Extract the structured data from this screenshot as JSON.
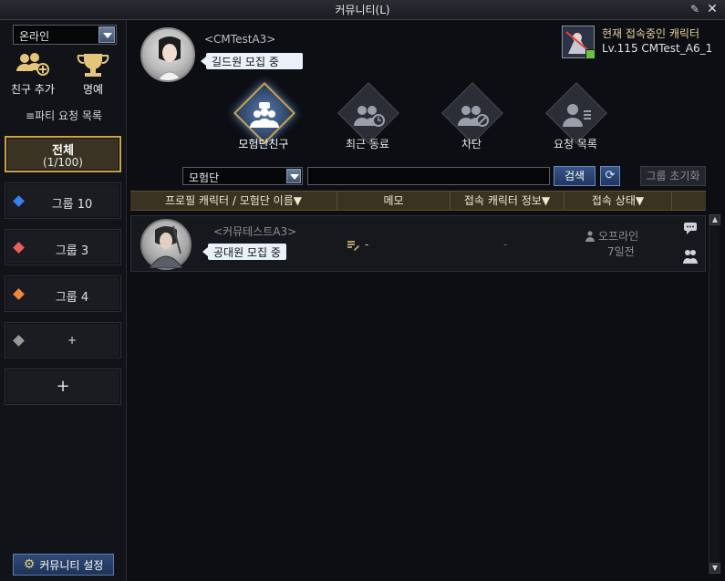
{
  "window": {
    "title": "커뮤니티(L)"
  },
  "sidebar": {
    "status": "온라인",
    "add_friend_label": "친구 추가",
    "honor_label": "명예",
    "party_list_label": "≡파티 요청 목록",
    "groups": [
      {
        "label": "전체",
        "count": "(1/100)",
        "color": "#c9a24a"
      },
      {
        "label": "그룹 10",
        "color": "#3a7ef0"
      },
      {
        "label": "그룹 3",
        "color": "#e8605a"
      },
      {
        "label": "그룹 4",
        "color": "#f08a3a"
      },
      {
        "label": "+",
        "color": "#9a9a9a"
      },
      {
        "label": "+"
      }
    ],
    "settings_label": "커뮤니티 설정"
  },
  "profile": {
    "name": "<CMTestA3>",
    "bubble": "길드원 모집 중",
    "current_char_label": "현재 접속중인 캐릭터",
    "current_char_level": "Lv.115 CMTest_A6_1"
  },
  "tabs": [
    {
      "label": "모험단친구",
      "active": true
    },
    {
      "label": "최근 동료"
    },
    {
      "label": "차단"
    },
    {
      "label": "요청 목록"
    }
  ],
  "search": {
    "filter": "모험단",
    "button": "검색",
    "reset": "그룹 초기화"
  },
  "table": {
    "headers": [
      "프로필 캐릭터 / 모험단 이름▼",
      "메모",
      "접속 캐릭터 정보▼",
      "접속 상태▼"
    ],
    "rows": [
      {
        "name": "<커뮤테스트A3>",
        "bubble": "공대원 모집 중",
        "memo": "-",
        "char_info": "-",
        "status": "오프라인",
        "since": "7일전"
      }
    ]
  }
}
